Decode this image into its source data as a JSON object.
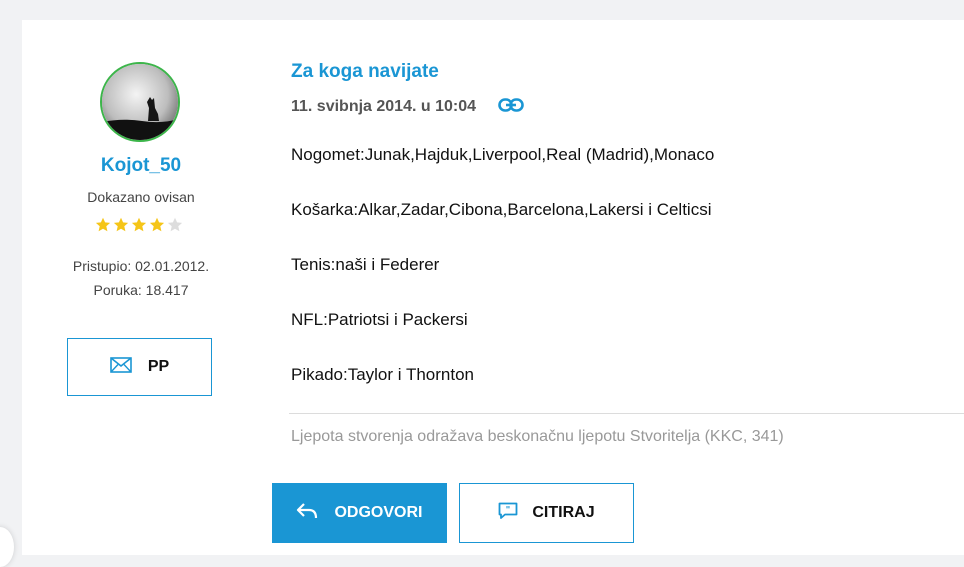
{
  "author": {
    "username": "Kojot_50",
    "rank": "Dokazano ovisan",
    "stars_filled": 4,
    "stars_total": 5,
    "joined": "Pristupio: 02.01.2012.",
    "posts": "Poruka: 18.417",
    "pm_label": "PP"
  },
  "post": {
    "title": "Za koga navijate",
    "date": "11. svibnja 2014. u 10:04",
    "lines": [
      "Nogomet:Junak,Hajduk,Liverpool,Real (Madrid),Monaco",
      "Košarka:Alkar,Zadar,Cibona,Barcelona,Lakersi i Celticsi",
      "Tenis:naši i Federer",
      "NFL:Patriotsi i Packersi",
      "Pikado:Taylor i Thornton"
    ],
    "signature": "Ljepota stvorenja odražava beskonačnu ljepotu Stvoritelja (KKC, 341)"
  },
  "actions": {
    "reply_label": "ODGOVORI",
    "quote_label": "CITIRAJ"
  },
  "colors": {
    "accent": "#1a96d4",
    "star": "#f5c518",
    "star_empty": "#dddddd",
    "avatar_border": "#3cb54a"
  },
  "icons": {
    "permalink": "link-icon",
    "pm": "envelope-icon",
    "reply": "reply-arrow-icon",
    "quote": "quote-bubble-icon"
  }
}
